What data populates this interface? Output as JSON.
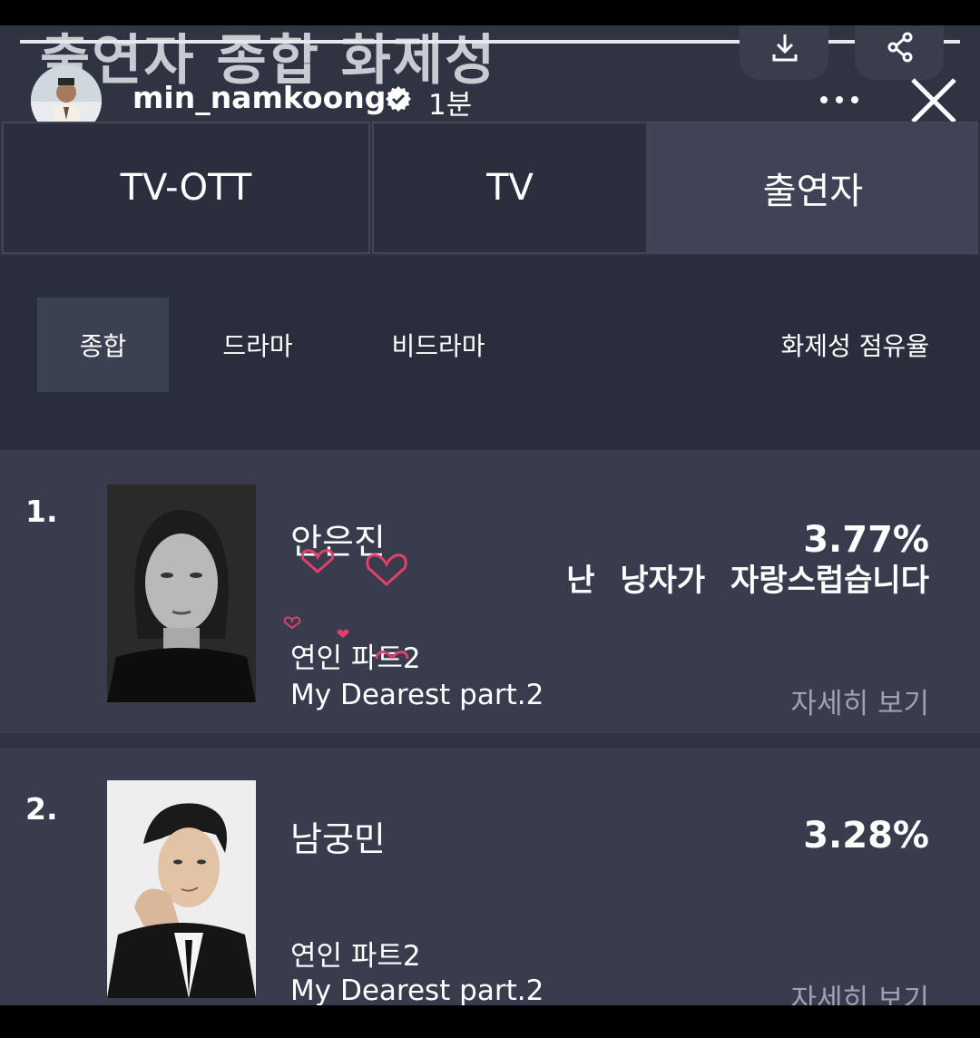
{
  "header": {
    "page_title": "출연자 종합 화제성",
    "username": "min_namkoong",
    "post_time": "1분"
  },
  "icons": {
    "download": "download-icon",
    "share": "share-icon",
    "verified": "verified-badge-icon",
    "more": "more-horizontal-icon",
    "close": "close-icon"
  },
  "tabs": [
    {
      "label": "TV-OTT",
      "active": false
    },
    {
      "label": "TV",
      "active": false
    },
    {
      "label": "출연자",
      "active": true
    }
  ],
  "subtabs": [
    {
      "label": "종합",
      "active": true
    },
    {
      "label": "드라마",
      "active": false
    },
    {
      "label": "비드라마",
      "active": false
    }
  ],
  "share_label": "화제성 점유율",
  "rankings": [
    {
      "rank": "1.",
      "name": "안은진",
      "percent": "3.77%",
      "show_ko": "연인 파트2",
      "show_en": "My Dearest part.2",
      "detail": "자세히 보기",
      "overlay_text": "난 낭자가 자랑스럽습니다"
    },
    {
      "rank": "2.",
      "name": "남궁민",
      "percent": "3.28%",
      "show_ko": "연인 파트2",
      "show_en": "My Dearest part.2",
      "detail": "자세히 보기"
    }
  ],
  "colors": {
    "background": "#2f3342",
    "card": "#383c4d",
    "active_tab": "#3f4355",
    "heart": "#e0406a",
    "muted_text": "#9ea2b0"
  }
}
